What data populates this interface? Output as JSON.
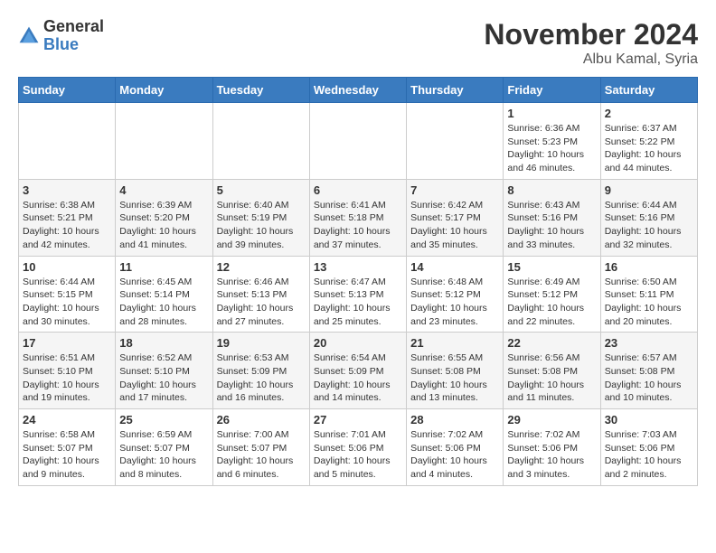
{
  "logo": {
    "general": "General",
    "blue": "Blue"
  },
  "title": "November 2024",
  "location": "Albu Kamal, Syria",
  "days_header": [
    "Sunday",
    "Monday",
    "Tuesday",
    "Wednesday",
    "Thursday",
    "Friday",
    "Saturday"
  ],
  "weeks": [
    [
      {
        "day": "",
        "info": ""
      },
      {
        "day": "",
        "info": ""
      },
      {
        "day": "",
        "info": ""
      },
      {
        "day": "",
        "info": ""
      },
      {
        "day": "",
        "info": ""
      },
      {
        "day": "1",
        "info": "Sunrise: 6:36 AM\nSunset: 5:23 PM\nDaylight: 10 hours\nand 46 minutes."
      },
      {
        "day": "2",
        "info": "Sunrise: 6:37 AM\nSunset: 5:22 PM\nDaylight: 10 hours\nand 44 minutes."
      }
    ],
    [
      {
        "day": "3",
        "info": "Sunrise: 6:38 AM\nSunset: 5:21 PM\nDaylight: 10 hours\nand 42 minutes."
      },
      {
        "day": "4",
        "info": "Sunrise: 6:39 AM\nSunset: 5:20 PM\nDaylight: 10 hours\nand 41 minutes."
      },
      {
        "day": "5",
        "info": "Sunrise: 6:40 AM\nSunset: 5:19 PM\nDaylight: 10 hours\nand 39 minutes."
      },
      {
        "day": "6",
        "info": "Sunrise: 6:41 AM\nSunset: 5:18 PM\nDaylight: 10 hours\nand 37 minutes."
      },
      {
        "day": "7",
        "info": "Sunrise: 6:42 AM\nSunset: 5:17 PM\nDaylight: 10 hours\nand 35 minutes."
      },
      {
        "day": "8",
        "info": "Sunrise: 6:43 AM\nSunset: 5:16 PM\nDaylight: 10 hours\nand 33 minutes."
      },
      {
        "day": "9",
        "info": "Sunrise: 6:44 AM\nSunset: 5:16 PM\nDaylight: 10 hours\nand 32 minutes."
      }
    ],
    [
      {
        "day": "10",
        "info": "Sunrise: 6:44 AM\nSunset: 5:15 PM\nDaylight: 10 hours\nand 30 minutes."
      },
      {
        "day": "11",
        "info": "Sunrise: 6:45 AM\nSunset: 5:14 PM\nDaylight: 10 hours\nand 28 minutes."
      },
      {
        "day": "12",
        "info": "Sunrise: 6:46 AM\nSunset: 5:13 PM\nDaylight: 10 hours\nand 27 minutes."
      },
      {
        "day": "13",
        "info": "Sunrise: 6:47 AM\nSunset: 5:13 PM\nDaylight: 10 hours\nand 25 minutes."
      },
      {
        "day": "14",
        "info": "Sunrise: 6:48 AM\nSunset: 5:12 PM\nDaylight: 10 hours\nand 23 minutes."
      },
      {
        "day": "15",
        "info": "Sunrise: 6:49 AM\nSunset: 5:12 PM\nDaylight: 10 hours\nand 22 minutes."
      },
      {
        "day": "16",
        "info": "Sunrise: 6:50 AM\nSunset: 5:11 PM\nDaylight: 10 hours\nand 20 minutes."
      }
    ],
    [
      {
        "day": "17",
        "info": "Sunrise: 6:51 AM\nSunset: 5:10 PM\nDaylight: 10 hours\nand 19 minutes."
      },
      {
        "day": "18",
        "info": "Sunrise: 6:52 AM\nSunset: 5:10 PM\nDaylight: 10 hours\nand 17 minutes."
      },
      {
        "day": "19",
        "info": "Sunrise: 6:53 AM\nSunset: 5:09 PM\nDaylight: 10 hours\nand 16 minutes."
      },
      {
        "day": "20",
        "info": "Sunrise: 6:54 AM\nSunset: 5:09 PM\nDaylight: 10 hours\nand 14 minutes."
      },
      {
        "day": "21",
        "info": "Sunrise: 6:55 AM\nSunset: 5:08 PM\nDaylight: 10 hours\nand 13 minutes."
      },
      {
        "day": "22",
        "info": "Sunrise: 6:56 AM\nSunset: 5:08 PM\nDaylight: 10 hours\nand 11 minutes."
      },
      {
        "day": "23",
        "info": "Sunrise: 6:57 AM\nSunset: 5:08 PM\nDaylight: 10 hours\nand 10 minutes."
      }
    ],
    [
      {
        "day": "24",
        "info": "Sunrise: 6:58 AM\nSunset: 5:07 PM\nDaylight: 10 hours\nand 9 minutes."
      },
      {
        "day": "25",
        "info": "Sunrise: 6:59 AM\nSunset: 5:07 PM\nDaylight: 10 hours\nand 8 minutes."
      },
      {
        "day": "26",
        "info": "Sunrise: 7:00 AM\nSunset: 5:07 PM\nDaylight: 10 hours\nand 6 minutes."
      },
      {
        "day": "27",
        "info": "Sunrise: 7:01 AM\nSunset: 5:06 PM\nDaylight: 10 hours\nand 5 minutes."
      },
      {
        "day": "28",
        "info": "Sunrise: 7:02 AM\nSunset: 5:06 PM\nDaylight: 10 hours\nand 4 minutes."
      },
      {
        "day": "29",
        "info": "Sunrise: 7:02 AM\nSunset: 5:06 PM\nDaylight: 10 hours\nand 3 minutes."
      },
      {
        "day": "30",
        "info": "Sunrise: 7:03 AM\nSunset: 5:06 PM\nDaylight: 10 hours\nand 2 minutes."
      }
    ]
  ]
}
